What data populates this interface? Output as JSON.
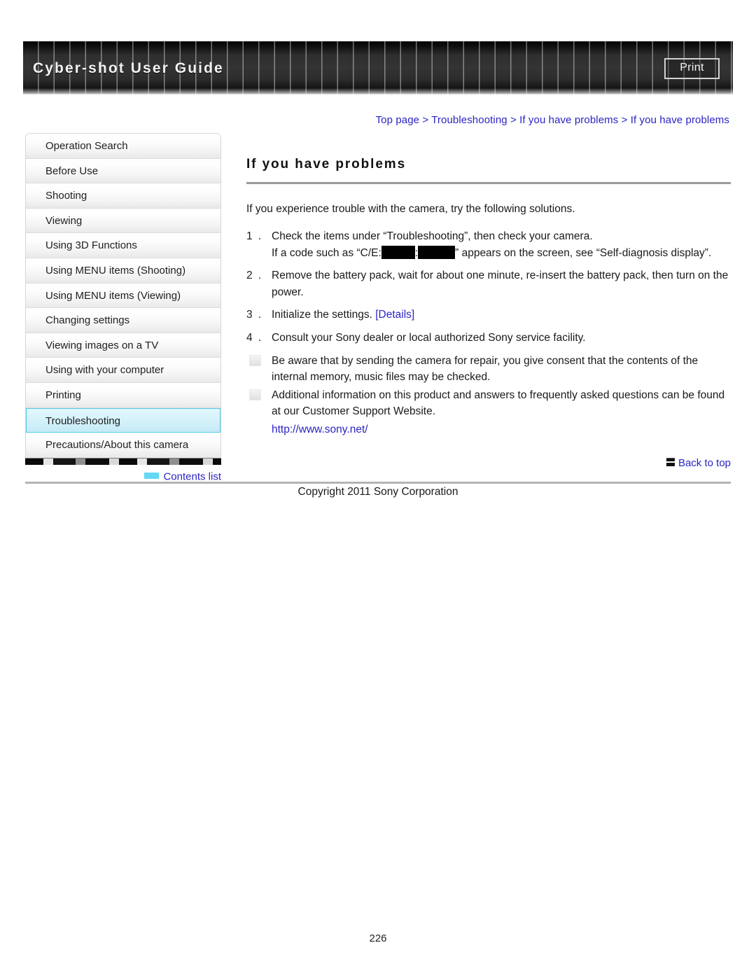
{
  "header": {
    "title": "Cyber-shot User Guide",
    "print_label": "Print"
  },
  "breadcrumb": {
    "text": "Top page > Troubleshooting > If you have problems > If you have problems"
  },
  "sidebar": {
    "items": [
      {
        "label": "Operation Search",
        "selected": false
      },
      {
        "label": "Before Use",
        "selected": false
      },
      {
        "label": "Shooting",
        "selected": false
      },
      {
        "label": "Viewing",
        "selected": false
      },
      {
        "label": "Using 3D Functions",
        "selected": false
      },
      {
        "label": "Using MENU items (Shooting)",
        "selected": false
      },
      {
        "label": "Using MENU items (Viewing)",
        "selected": false
      },
      {
        "label": "Changing settings",
        "selected": false
      },
      {
        "label": "Viewing images on a TV",
        "selected": false
      },
      {
        "label": "Using with your computer",
        "selected": false
      },
      {
        "label": "Printing",
        "selected": false
      },
      {
        "label": "Troubleshooting",
        "selected": true
      },
      {
        "label": "Precautions/About this camera",
        "selected": false
      }
    ],
    "contents_list_label": "Contents list"
  },
  "main": {
    "heading": "If you have problems",
    "intro": "If you experience trouble with the camera, try the following solutions.",
    "steps": [
      {
        "number": "1 .",
        "line1": "Check the items under “Troubleshooting”, then check your camera.",
        "line2_prefix": "If a code such as “C/E:",
        "line2_separator": ":",
        "line2_suffix": "” appears on the screen, see “Self-diagnosis display”."
      },
      {
        "number": "2 .",
        "line1": "Remove the battery pack, wait for about one minute, re-insert the battery pack, then turn on the power."
      },
      {
        "number": "3 .",
        "line1": "Initialize the settings.",
        "link": "[Details]"
      },
      {
        "number": "4 .",
        "line1": "Consult your Sony dealer or local authorized Sony service facility."
      }
    ],
    "notes": [
      "Be aware that by sending the camera for repair, you give consent that the contents of the internal memory, music files may be checked.",
      "Additional information on this product and answers to frequently asked questions can be found at our Customer Support Website."
    ],
    "note_url": "http://www.sony.net/",
    "back_to_top_label": "Back to top"
  },
  "footer": {
    "copyright": "Copyright 2011 Sony Corporation",
    "page_number": "226"
  }
}
